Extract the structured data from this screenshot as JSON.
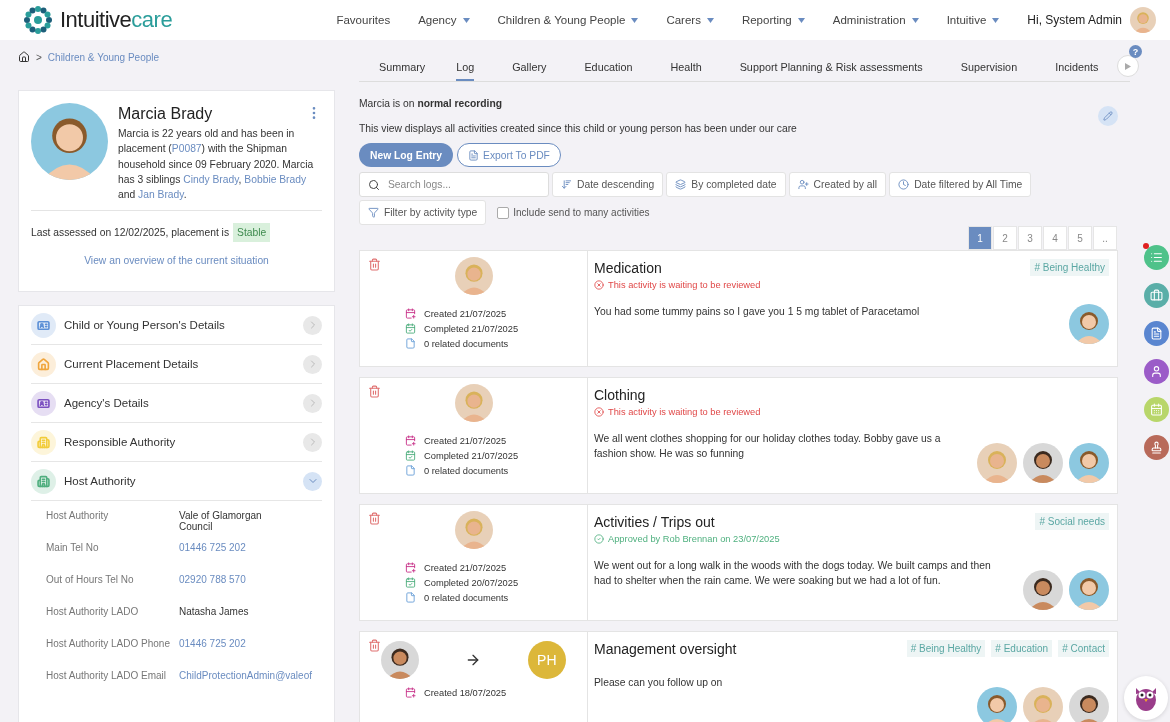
{
  "logo": {
    "first": "Intuitive",
    "second": "care"
  },
  "nav": [
    {
      "label": "Favourites",
      "dropdown": false
    },
    {
      "label": "Agency",
      "dropdown": true
    },
    {
      "label": "Children & Young People",
      "dropdown": true
    },
    {
      "label": "Carers",
      "dropdown": true
    },
    {
      "label": "Reporting",
      "dropdown": true
    },
    {
      "label": "Administration",
      "dropdown": true
    },
    {
      "label": "Intuitive",
      "dropdown": true
    }
  ],
  "greeting": "Hi, System Admin",
  "breadcrumb_separator": ">",
  "breadcrumb": "Children & Young People",
  "help": "?",
  "tabs": [
    {
      "label": "Summary",
      "selected": false
    },
    {
      "label": "Log",
      "selected": true
    },
    {
      "label": "Gallery",
      "selected": false
    },
    {
      "label": "Education",
      "selected": false
    },
    {
      "label": "Health",
      "selected": false
    },
    {
      "label": "Support Planning & Risk assessments",
      "selected": false
    },
    {
      "label": "Supervision",
      "selected": false
    },
    {
      "label": "Incidents",
      "selected": false
    }
  ],
  "profile": {
    "name": "Marcia Brady",
    "bio": [
      {
        "text": "Marcia is 22 years old and has been in placement (",
        "link": false
      },
      {
        "text": "P0087",
        "link": true
      },
      {
        "text": ") with the Shipman household since 09 February 2020. Marcia has 3 siblings ",
        "link": false
      },
      {
        "text": "Cindy Brady",
        "link": true
      },
      {
        "text": ", ",
        "link": false
      },
      {
        "text": "Bobbie Brady",
        "link": true
      },
      {
        "text": " and ",
        "link": false
      },
      {
        "text": "Jan Brady",
        "link": true
      },
      {
        "text": ".",
        "link": false
      }
    ],
    "assessment": "Last assessed on 12/02/2025, placement is",
    "placement_status": "Stable",
    "overview_link": "View an overview of the current situation"
  },
  "sections": [
    {
      "title": "Child or Young Person's Details",
      "color": "#5b8fd6",
      "expanded": false
    },
    {
      "title": "Current Placement Details",
      "color": "#f0a53c",
      "expanded": false
    },
    {
      "title": "Agency's Details",
      "color": "#7b4fc0",
      "expanded": false
    },
    {
      "title": "Responsible Authority",
      "color": "#f2cc3a",
      "expanded": false
    },
    {
      "title": "Host Authority",
      "color": "#4fae7e",
      "expanded": true,
      "details": [
        {
          "label": "Host Authority",
          "value": "Vale of Glamorgan Council",
          "link": false
        },
        {
          "label": "Main Tel No",
          "value": "01446 725 202",
          "link": true
        },
        {
          "label": "Out of Hours Tel No",
          "value": "02920 788 570",
          "link": true
        },
        {
          "label": "Host Authority LADO",
          "value": "Natasha James",
          "link": false
        },
        {
          "label": "Host Authority LADO Phone",
          "value": "01446 725 202",
          "link": true
        },
        {
          "label": "Host Authority LADO Email",
          "value": "ChildProtectionAdmin@valeof",
          "link": true
        }
      ]
    }
  ],
  "recording": "Marcia is on **normal recording**",
  "description": "This view displays all activities created since this child or young person has been under our care",
  "new_entry_button": "New Log Entry",
  "export_button": "Export To PDF",
  "search": {
    "placeholder": "Search logs..."
  },
  "filters": [
    "Date descending",
    "By completed date",
    "Created by all",
    "Date filtered by All Time",
    "Filter by activity type"
  ],
  "include_many": {
    "label": "Include send to many activities",
    "checked": false
  },
  "pages": [
    {
      "label": "1",
      "selected": true
    },
    {
      "label": "2",
      "selected": false
    },
    {
      "label": "3",
      "selected": false
    },
    {
      "label": "4",
      "selected": false
    },
    {
      "label": "5",
      "selected": false
    },
    {
      "label": "..",
      "selected": false
    }
  ],
  "entries": [
    {
      "title": "Medication",
      "status": {
        "kind": "pending",
        "text": "This activity is waiting to be reviewed"
      },
      "tags": [
        "# Being Healthy"
      ],
      "body": "You had some tummy pains so I gave you 1 5 mg tablet of Paracetamol",
      "created": "Created 21/07/2025",
      "completed": "Completed 21/07/2025",
      "documents": "0 related documents",
      "participants": [
        {
          "kind": "picture"
        }
      ]
    },
    {
      "title": "Clothing",
      "status": {
        "kind": "pending",
        "text": "This activity is waiting to be reviewed"
      },
      "body": "We all went clothes shopping for our holiday clothes today. Bobby gave us a fashion show. He was so funning",
      "created": "Created 21/07/2025",
      "completed": "Completed 21/07/2025",
      "documents": "0 related documents",
      "participants": [
        {
          "kind": "picture"
        },
        {
          "kind": "picture"
        },
        {
          "kind": "picture"
        }
      ]
    },
    {
      "title": "Activities / Trips out",
      "status": {
        "kind": "approved",
        "text": "Approved by Rob Brennan on 23/07/2025"
      },
      "tags": [
        "# Social needs"
      ],
      "body": "We went out for a long walk in the woods with the dogs today. We built camps and then had to shelter when the rain came. We were soaking but we had a lot of fun.",
      "created": "Created 21/07/2025",
      "completed": "Completed 20/07/2025",
      "documents": "0 related documents",
      "participants": [
        {
          "kind": "picture"
        },
        {
          "kind": "picture"
        }
      ]
    },
    {
      "title": "Management oversight",
      "recipient": "PH",
      "tags": [
        "# Being Healthy",
        "# Education",
        "# Contact"
      ],
      "body": "Please can you follow up on",
      "created": "Created 18/07/2025",
      "participants": [
        {
          "kind": "picture"
        },
        {
          "kind": "picture"
        },
        {
          "kind": "picture"
        }
      ]
    }
  ]
}
